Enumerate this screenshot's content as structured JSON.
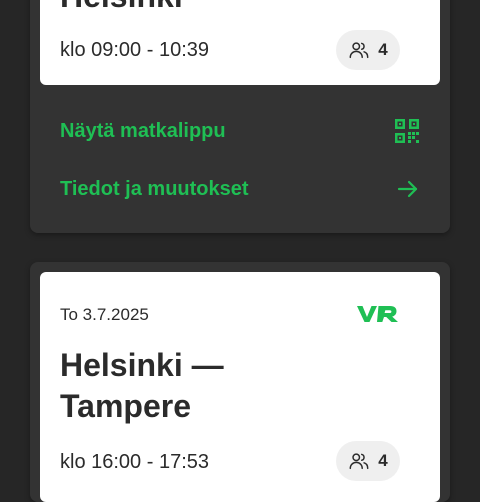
{
  "trip1": {
    "title": "Helsinki",
    "time": "klo 09:00 - 10:39",
    "passengers": "4",
    "actions": [
      {
        "label": "Näytä matkalippu",
        "icon": "qr-code-icon"
      },
      {
        "label": "Tiedot ja muutokset",
        "icon": "arrow-right-icon"
      }
    ]
  },
  "trip2": {
    "date": "To 3.7.2025",
    "logo": "VR",
    "title_line1": "Helsinki —",
    "title_line2": "Tampere",
    "time": "klo 16:00 - 17:53",
    "passengers": "4"
  },
  "colors": {
    "accent": "#1fbf54",
    "background": "#262626",
    "card_dark": "#333333",
    "card_light": "#ffffff",
    "text": "#2b2b2b",
    "chip": "#efefef"
  }
}
